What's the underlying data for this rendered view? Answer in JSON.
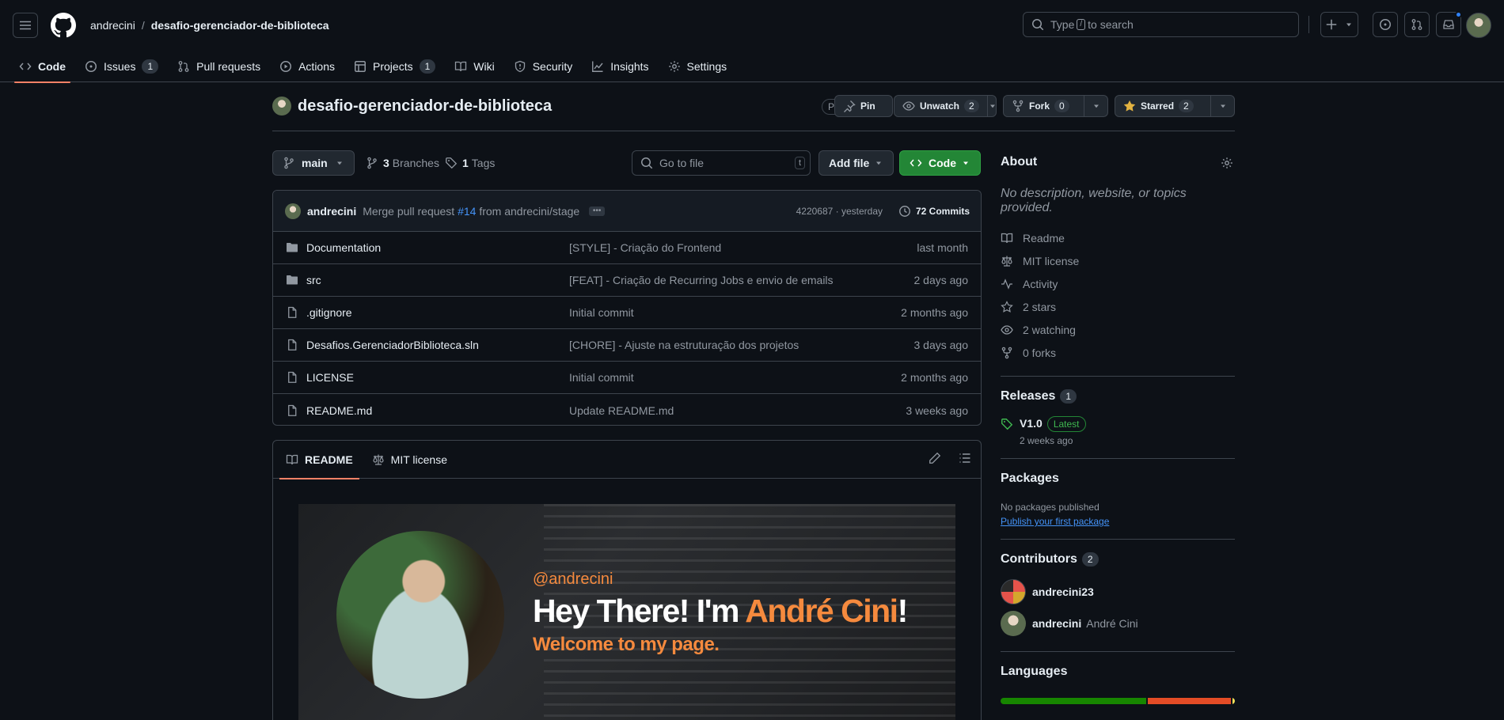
{
  "header": {
    "owner": "andrecini",
    "separator": "/",
    "repo": "desafio-gerenciador-de-biblioteca",
    "search_prefix": "Type",
    "search_key": "/",
    "search_suffix": "to search"
  },
  "nav": {
    "tabs": [
      {
        "label": "Code",
        "icon": "code-icon",
        "active": true
      },
      {
        "label": "Issues",
        "icon": "issue-icon",
        "count": "1"
      },
      {
        "label": "Pull requests",
        "icon": "pull-request-icon"
      },
      {
        "label": "Actions",
        "icon": "play-icon"
      },
      {
        "label": "Projects",
        "icon": "table-icon",
        "count": "1"
      },
      {
        "label": "Wiki",
        "icon": "book-icon"
      },
      {
        "label": "Security",
        "icon": "shield-icon"
      },
      {
        "label": "Insights",
        "icon": "graph-icon"
      },
      {
        "label": "Settings",
        "icon": "gear-icon"
      }
    ]
  },
  "repo": {
    "title": "desafio-gerenciador-de-biblioteca",
    "visibility": "Public",
    "pin_label": "Pin",
    "unwatch_label": "Unwatch",
    "watch_count": "2",
    "fork_label": "Fork",
    "fork_count": "0",
    "star_label": "Starred",
    "star_count": "2"
  },
  "toolbar": {
    "branch": "main",
    "branches_count": "3",
    "branches_label": "Branches",
    "tags_count": "1",
    "tags_label": "Tags",
    "gofile_placeholder": "Go to file",
    "gofile_key": "t",
    "addfile_label": "Add file",
    "code_label": "Code"
  },
  "commit": {
    "author": "andrecini",
    "msg_prefix": "Merge pull request",
    "pr": "#14",
    "msg_suffix": "from andrecini/stage",
    "sha": "4220687 · yesterday",
    "commits_label": "72 Commits"
  },
  "files": [
    {
      "name": "Documentation",
      "type": "dir",
      "message": "[STYLE] - Criação do Frontend",
      "age": "last month"
    },
    {
      "name": "src",
      "type": "dir",
      "message": "[FEAT] - Criação de Recurring Jobs e envio de emails",
      "age": "2 days ago"
    },
    {
      "name": ".gitignore",
      "type": "file",
      "message": "Initial commit",
      "age": "2 months ago"
    },
    {
      "name": "Desafios.GerenciadorBiblioteca.sln",
      "type": "file",
      "message": "[CHORE] - Ajuste na estruturação dos projetos",
      "age": "3 days ago"
    },
    {
      "name": "LICENSE",
      "type": "file",
      "message": "Initial commit",
      "age": "2 months ago"
    },
    {
      "name": "README.md",
      "type": "file",
      "message": "Update README.md",
      "age": "3 weeks ago"
    }
  ],
  "readme": {
    "tab_readme": "README",
    "tab_license": "MIT license",
    "banner_handle": "@andrecini",
    "banner_hey": "Hey There! I'm",
    "banner_name": "André Cini",
    "banner_bang": "!",
    "banner_welcome": "Welcome to my page."
  },
  "about": {
    "title": "About",
    "description": "No description, website, or topics provided.",
    "items": [
      {
        "label": "Readme",
        "icon": "book-icon"
      },
      {
        "label": "MIT license",
        "icon": "law-icon"
      },
      {
        "label": "Activity",
        "icon": "pulse-icon"
      },
      {
        "label": "2 stars",
        "icon": "star-icon"
      },
      {
        "label": "2 watching",
        "icon": "eye-icon"
      },
      {
        "label": "0 forks",
        "icon": "fork-icon"
      }
    ]
  },
  "releases": {
    "title": "Releases",
    "count": "1",
    "name": "V1.0",
    "badge": "Latest",
    "date": "2 weeks ago"
  },
  "packages": {
    "title": "Packages",
    "none": "No packages published",
    "link": "Publish your first package"
  },
  "contributors": {
    "title": "Contributors",
    "count": "2",
    "list": [
      {
        "login": "andrecini23",
        "name": ""
      },
      {
        "login": "andrecini",
        "name": "André Cini"
      }
    ]
  },
  "languages": {
    "title": "Languages",
    "segments": [
      {
        "fraction": 0.63,
        "color": "#178600"
      },
      {
        "fraction": 0.36,
        "color": "#e34c26"
      },
      {
        "fraction": 0.01,
        "color": "#f1e05a"
      }
    ]
  },
  "colors": {
    "accent": "#f78166",
    "primary_button": "#238636",
    "link": "#4493f8",
    "banner_accent": "#f58a3e"
  }
}
